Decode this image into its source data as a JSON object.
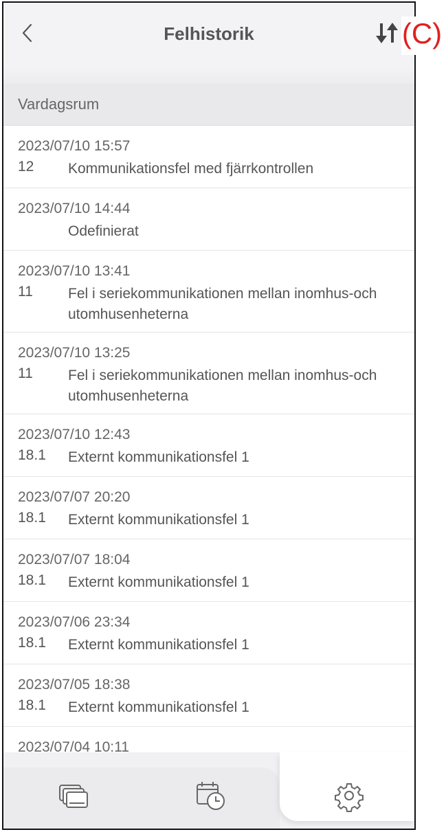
{
  "header": {
    "title": "Felhistorik",
    "annotation": "(C)"
  },
  "section": {
    "title": "Vardagsrum"
  },
  "errors": [
    {
      "date": "2023/07/10 15:57",
      "code": "12",
      "message": "Kommunikationsfel med fjärrkontrollen"
    },
    {
      "date": "2023/07/10 14:44",
      "code": "",
      "message": "Odefinierat"
    },
    {
      "date": "2023/07/10 13:41",
      "code": "11",
      "message": "Fel i seriekommunikationen mellan inomhus-och utomhusenheterna"
    },
    {
      "date": "2023/07/10 13:25",
      "code": "11",
      "message": "Fel i seriekommunikationen mellan inomhus-och utomhusenheterna"
    },
    {
      "date": "2023/07/10 12:43",
      "code": "18.1",
      "message": "Externt kommunikationsfel 1"
    },
    {
      "date": "2023/07/07 20:20",
      "code": "18.1",
      "message": "Externt kommunikationsfel 1"
    },
    {
      "date": "2023/07/07 18:04",
      "code": "18.1",
      "message": "Externt kommunikationsfel 1"
    },
    {
      "date": "2023/07/06 23:34",
      "code": "18.1",
      "message": "Externt kommunikationsfel 1"
    },
    {
      "date": "2023/07/05 18:38",
      "code": "18.1",
      "message": "Externt kommunikationsfel 1"
    },
    {
      "date": "2023/07/04 10:11",
      "code": "",
      "message": ""
    }
  ],
  "tabbar": {
    "tabs": [
      {
        "icon": "devices-icon"
      },
      {
        "icon": "schedule-icon"
      },
      {
        "icon": "settings-gear-icon",
        "active": true
      }
    ]
  },
  "colors": {
    "annotation": "#e02020",
    "header_bg": "#f3f3f5",
    "section_bg": "#e9e9eb",
    "text": "#555555"
  }
}
